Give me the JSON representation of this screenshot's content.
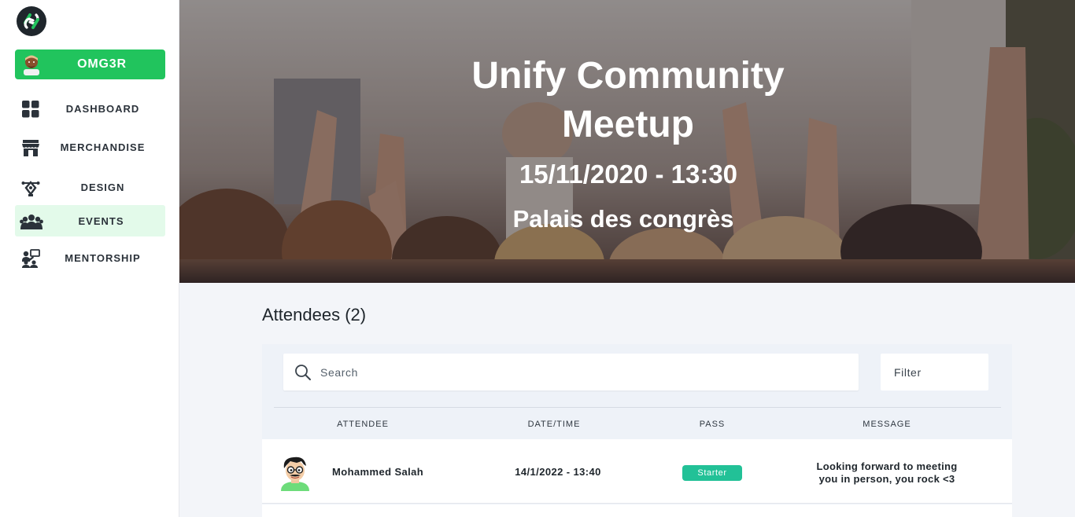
{
  "app": {
    "brand_color": "#21c45d"
  },
  "sidebar": {
    "user": {
      "name": "OMG3R"
    },
    "items": [
      {
        "label": "DASHBOARD",
        "icon": "dashboard-icon"
      },
      {
        "label": "MERCHANDISE",
        "icon": "store-icon"
      },
      {
        "label": "DESIGN",
        "icon": "design-pen-icon"
      },
      {
        "label": "EVENTS",
        "icon": "people-group-icon",
        "active": true
      },
      {
        "label": "MENTORSHIP",
        "icon": "mentorship-icon"
      }
    ]
  },
  "event": {
    "title": "Unify Community Meetup",
    "datetime": "15/11/2020 - 13:30",
    "venue": "Palais des congrès"
  },
  "attendees": {
    "heading": "Attendees (2)",
    "search_placeholder": "Search",
    "filter_label": "Filter",
    "columns": [
      "ATTENDEE",
      "DATE/TIME",
      "PASS",
      "MESSAGE"
    ],
    "rows": [
      {
        "name": "Mohammed Salah",
        "datetime": "14/1/2022 - 13:40",
        "pass": "Starter",
        "message": "Looking forward to meeting you in person, you rock <3"
      }
    ]
  }
}
